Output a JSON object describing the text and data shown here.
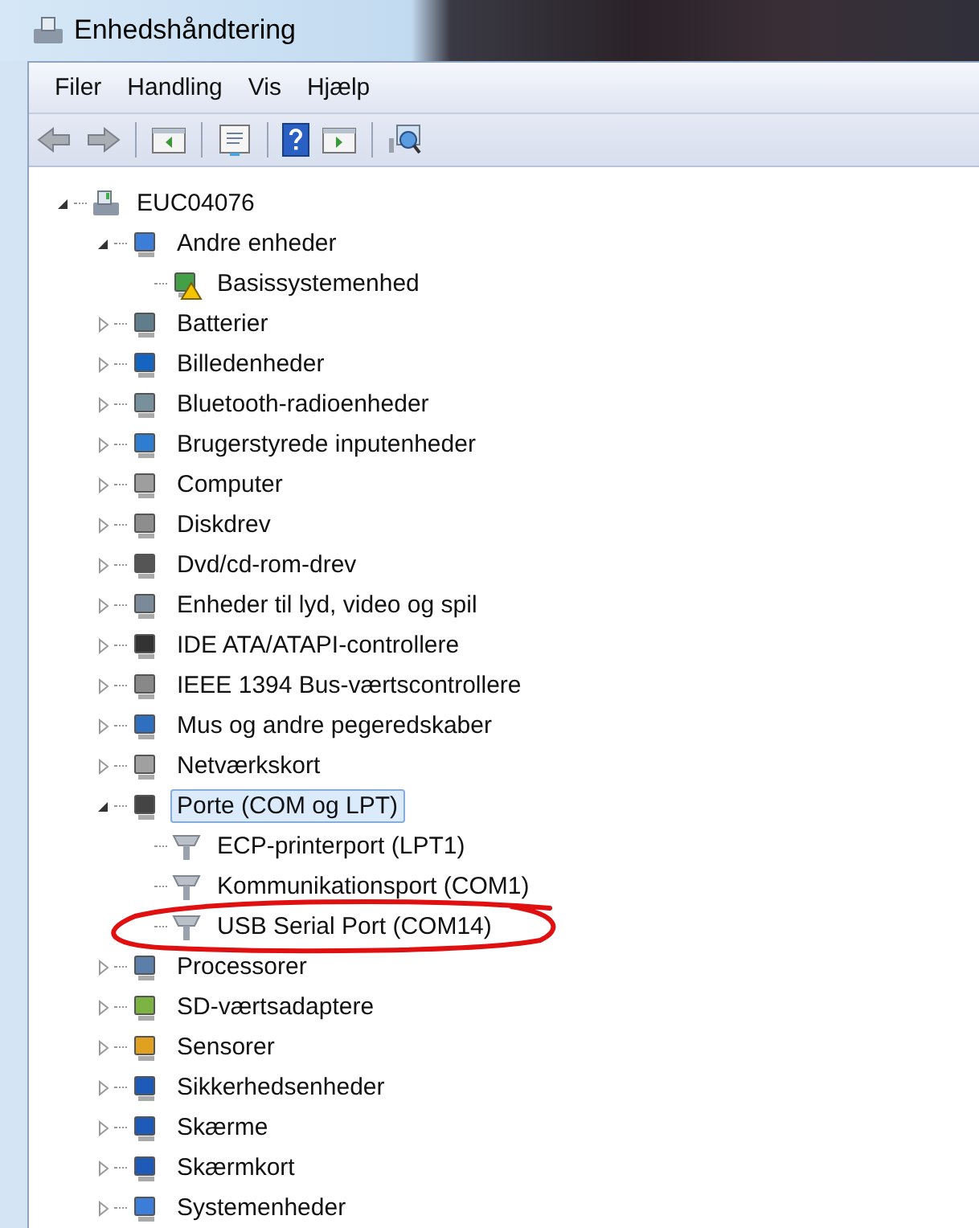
{
  "window": {
    "title": "Enhedshåndtering"
  },
  "menu": [
    "Filer",
    "Handling",
    "Vis",
    "Hjælp"
  ],
  "tree": {
    "label": "EUC04076",
    "expanded": true,
    "selected": false,
    "warning": false,
    "children": [
      {
        "label": "Andre enheder",
        "expanded": true,
        "selected": false,
        "warning": false,
        "children": [
          {
            "label": "Basissystemenhed",
            "selected": false,
            "warning": true
          }
        ]
      },
      {
        "label": "Batterier",
        "expanded": false,
        "selected": false,
        "warning": false
      },
      {
        "label": "Billedenheder",
        "expanded": false,
        "selected": false,
        "warning": false
      },
      {
        "label": "Bluetooth-radioenheder",
        "expanded": false,
        "selected": false,
        "warning": false
      },
      {
        "label": "Brugerstyrede inputenheder",
        "expanded": false,
        "selected": false,
        "warning": false
      },
      {
        "label": "Computer",
        "expanded": false,
        "selected": false,
        "warning": false
      },
      {
        "label": "Diskdrev",
        "expanded": false,
        "selected": false,
        "warning": false
      },
      {
        "label": "Dvd/cd-rom-drev",
        "expanded": false,
        "selected": false,
        "warning": false
      },
      {
        "label": "Enheder til lyd, video og spil",
        "expanded": false,
        "selected": false,
        "warning": false
      },
      {
        "label": "IDE ATA/ATAPI-controllere",
        "expanded": false,
        "selected": false,
        "warning": false
      },
      {
        "label": "IEEE 1394 Bus-værtscontrollere",
        "expanded": false,
        "selected": false,
        "warning": false
      },
      {
        "label": "Mus og andre pegeredskaber",
        "expanded": false,
        "selected": false,
        "warning": false
      },
      {
        "label": "Netværkskort",
        "expanded": false,
        "selected": false,
        "warning": false
      },
      {
        "label": "Porte (COM og LPT)",
        "expanded": true,
        "selected": true,
        "warning": false,
        "children": [
          {
            "label": "ECP-printerport (LPT1)",
            "selected": false,
            "warning": false
          },
          {
            "label": "Kommunikationsport (COM1)",
            "selected": false,
            "warning": false
          },
          {
            "label": "USB Serial Port (COM14)",
            "selected": false,
            "warning": false
          }
        ]
      },
      {
        "label": "Processorer",
        "expanded": false,
        "selected": false,
        "warning": false
      },
      {
        "label": "SD-værtsadaptere",
        "expanded": false,
        "selected": false,
        "warning": false
      },
      {
        "label": "Sensorer",
        "expanded": false,
        "selected": false,
        "warning": false
      },
      {
        "label": "Sikkerhedsenheder",
        "expanded": false,
        "selected": false,
        "warning": false
      },
      {
        "label": "Skærme",
        "expanded": false,
        "selected": false,
        "warning": false
      },
      {
        "label": "Skærmkort",
        "expanded": false,
        "selected": false,
        "warning": false
      },
      {
        "label": "Systemenheder",
        "expanded": false,
        "selected": false,
        "warning": false
      }
    ]
  }
}
